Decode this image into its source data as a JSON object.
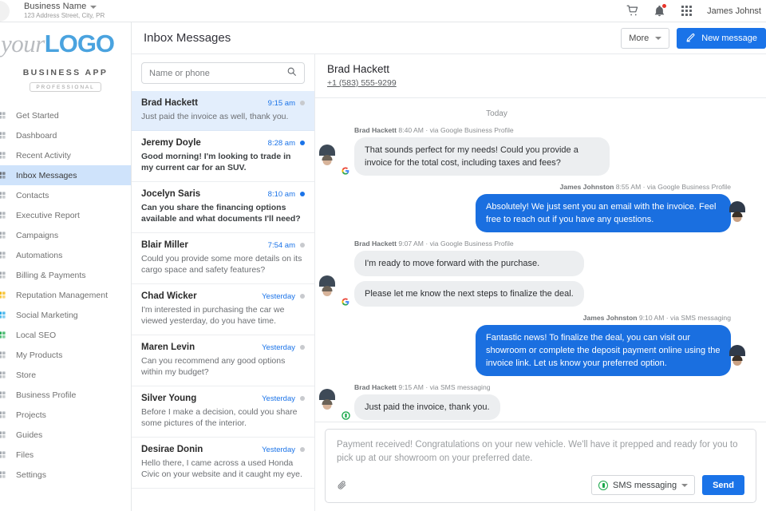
{
  "topbar": {
    "business_name": "Business Name",
    "business_address": "123 Address Street, City, PR",
    "icons": [
      "cart-icon",
      "bell-icon",
      "apps-grid-icon"
    ],
    "notification_badge": "",
    "user_name": "James Johnst"
  },
  "sidebar": {
    "logo": {
      "prefix": "your",
      "main": "LOGO",
      "subtitle": "BUSINESS APP",
      "tag": "PROFESSIONAL"
    },
    "items": [
      {
        "label": "Get Started",
        "icon": "rocket-icon",
        "color": "#9aa0a6",
        "active": false
      },
      {
        "label": "Dashboard",
        "icon": "dashboard-icon",
        "color": "#9aa0a6",
        "active": false
      },
      {
        "label": "Recent Activity",
        "icon": "activity-icon",
        "color": "#9aa0a6",
        "active": false
      },
      {
        "label": "Inbox Messages",
        "icon": "inbox-icon",
        "color": "#5f6368",
        "active": true
      },
      {
        "label": "Contacts",
        "icon": "contacts-icon",
        "color": "#9aa0a6",
        "active": false
      },
      {
        "label": "Executive Report",
        "icon": "report-icon",
        "color": "#9aa0a6",
        "active": false
      },
      {
        "label": "Campaigns",
        "icon": "campaign-icon",
        "color": "#9aa0a6",
        "active": false
      },
      {
        "label": "Automations",
        "icon": "automation-icon",
        "color": "#9aa0a6",
        "active": false
      },
      {
        "label": "Billing & Payments",
        "icon": "billing-icon",
        "color": "#9aa0a6",
        "active": false
      },
      {
        "label": "Reputation Management",
        "icon": "star-icon",
        "color": "#f5b400",
        "active": false
      },
      {
        "label": "Social Marketing",
        "icon": "social-icon",
        "color": "#1aa3e8",
        "active": false
      },
      {
        "label": "Local SEO",
        "icon": "seo-icon",
        "color": "#1aa84a",
        "active": false
      },
      {
        "label": "My Products",
        "icon": "products-icon",
        "color": "#9aa0a6",
        "active": false
      },
      {
        "label": "Store",
        "icon": "store-icon",
        "color": "#9aa0a6",
        "active": false
      },
      {
        "label": "Business Profile",
        "icon": "profile-icon",
        "color": "#9aa0a6",
        "active": false
      },
      {
        "label": "Projects",
        "icon": "projects-icon",
        "color": "#9aa0a6",
        "active": false
      },
      {
        "label": "Guides",
        "icon": "guides-icon",
        "color": "#9aa0a6",
        "active": false
      },
      {
        "label": "Files",
        "icon": "files-icon",
        "color": "#9aa0a6",
        "active": false
      },
      {
        "label": "Settings",
        "icon": "settings-icon",
        "color": "#9aa0a6",
        "active": false
      }
    ]
  },
  "main": {
    "title": "Inbox Messages",
    "more_label": "More",
    "new_message_label": "New message"
  },
  "search": {
    "placeholder": "Name or phone",
    "value": ""
  },
  "conversations": [
    {
      "name": "Brad Hackett",
      "time": "9:15 am",
      "snippet": "Just paid the invoice as well, thank you.",
      "unread": false,
      "selected": true
    },
    {
      "name": "Jeremy Doyle",
      "time": "8:28 am",
      "snippet": "Good morning! I'm looking to trade in my current car for an SUV.",
      "unread": true,
      "selected": false
    },
    {
      "name": "Jocelyn Saris",
      "time": "8:10 am",
      "snippet": "Can you share the financing options available and what documents I'll need?",
      "unread": true,
      "selected": false
    },
    {
      "name": "Blair Miller",
      "time": "7:54 am",
      "snippet": "Could you provide some more details on its cargo space and safety features?",
      "unread": false,
      "selected": false
    },
    {
      "name": "Chad Wicker",
      "time": "Yesterday",
      "snippet": "I'm interested in purchasing the car we viewed yesterday, do you have time.",
      "unread": false,
      "selected": false
    },
    {
      "name": "Maren Levin",
      "time": "Yesterday",
      "snippet": "Can you recommend any good options within my budget?",
      "unread": false,
      "selected": false
    },
    {
      "name": "Silver Young",
      "time": "Yesterday",
      "snippet": "Before I make a decision, could you share some pictures of the interior.",
      "unread": false,
      "selected": false
    },
    {
      "name": "Desirae Donin",
      "time": "Yesterday",
      "snippet": "Hello there, I came across a used Honda Civic on your website and it caught my eye.",
      "unread": false,
      "selected": false
    }
  ],
  "thread": {
    "contact_name": "Brad Hackett",
    "contact_phone": "+1 (583) 555-9299",
    "day_divider": "Today",
    "messages": [
      {
        "sender": "Brad Hackett",
        "time": "8:40 AM",
        "via": "via Google Business Profile",
        "direction": "in",
        "badge": "google-badge",
        "texts": [
          "That sounds perfect for my needs! Could you provide a invoice for the total cost, including taxes and fees?"
        ]
      },
      {
        "sender": "James Johnston",
        "time": "8:55 AM",
        "via": "via Google Business Profile",
        "direction": "out",
        "badge": "none",
        "texts": [
          "Absolutely! We just sent you an email with the invoice. Feel free to reach out if you have any questions."
        ]
      },
      {
        "sender": "Brad Hackett",
        "time": "9:07 AM",
        "via": "via Google Business Profile",
        "direction": "in",
        "badge": "google-badge",
        "texts": [
          "I'm ready to move forward with the purchase.",
          "Please let me know the next steps to finalize the deal."
        ]
      },
      {
        "sender": "James Johnston",
        "time": "9:10 AM",
        "via": "via SMS messaging",
        "direction": "out",
        "badge": "none",
        "texts": [
          "Fantastic news! To finalize the deal, you can visit our showroom or complete the deposit payment online using the invoice link. Let us know your preferred option."
        ]
      },
      {
        "sender": "Brad Hackett",
        "time": "9:15 AM",
        "via": "via SMS messaging",
        "direction": "in",
        "badge": "sms-badge",
        "texts": [
          "Just paid the invoice, thank you."
        ]
      }
    ]
  },
  "compose": {
    "text": "Payment received! Congratulations on your new vehicle. We'll have it prepped and ready for you to pick up at our showroom on your preferred date.",
    "attach_icon": "paperclip-icon",
    "channel_label": "SMS messaging",
    "send_label": "Send"
  },
  "colors": {
    "accent_blue": "#1a73e8",
    "bubble_out": "#1a6fe0",
    "bubble_in": "#eceef0",
    "selected_row": "#e3eefc",
    "logo_blue": "#4aa3df",
    "badge_red": "#e8352b",
    "sms_green": "#1aa84a"
  }
}
